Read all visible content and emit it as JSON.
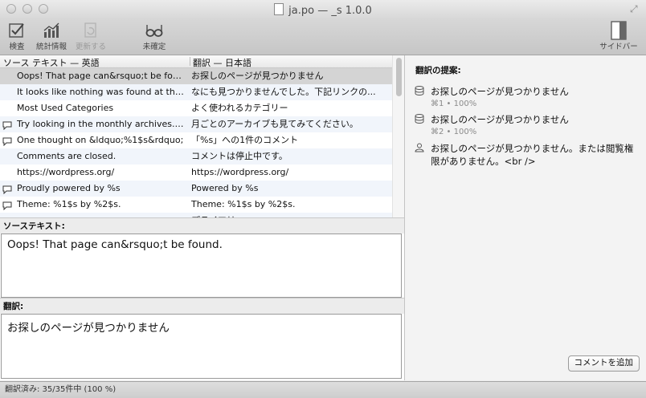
{
  "window": {
    "title": "ja.po — _s 1.0.0"
  },
  "toolbar": {
    "validate_label": "検査",
    "stats_label": "統計情報",
    "update_label": "更新する",
    "fuzzy_label": "未確定",
    "sidebar_label": "サイドバー"
  },
  "list": {
    "col_source": "ソース テキスト — 英語",
    "col_translation": "翻訳 — 日本語",
    "rows": [
      {
        "source": "Oops! That page can&rsquo;t be fou...",
        "translation": "お探しのページが見つかりません"
      },
      {
        "source": "It looks like nothing was found at thi...",
        "translation": "なにも見つかりませんでした。下記リンクの..."
      },
      {
        "source": "Most Used Categories",
        "translation": "よく使われるカテゴリー"
      },
      {
        "source": "Try looking in the monthly archives. ...",
        "translation": "月ごとのアーカイブも見てみてください。"
      },
      {
        "source": "One thought on &ldquo;%1$s&rdquo;",
        "translation": "「%s」への1件のコメント"
      },
      {
        "source": "Comments are closed.",
        "translation": "コメントは停止中です。"
      },
      {
        "source": "https://wordpress.org/",
        "translation": "https://wordpress.org/"
      },
      {
        "source": "Proudly powered by %s",
        "translation": "Powered by %s"
      },
      {
        "source": "Theme: %1$s by %2$s.",
        "translation": "Theme: %1$s by %2$s."
      },
      {
        "source": "",
        "translation": "プライマリ"
      }
    ]
  },
  "source_section": {
    "label": "ソーステキスト:",
    "text": "Oops! That page can&rsquo;t be found."
  },
  "translation_section": {
    "label": "翻訳:",
    "text": "お探しのページが見つかりません"
  },
  "sidebar": {
    "title": "翻訳の提案:",
    "suggestions": [
      {
        "text": "お探しのページが見つかりません",
        "meta": "⌘1 • 100%",
        "icon": "database-icon"
      },
      {
        "text": "お探しのページが見つかりません",
        "meta": "⌘2 • 100%",
        "icon": "database-icon"
      },
      {
        "text": "お探しのページが見つかりません。または閲覧権限がありません。<br />",
        "meta": "",
        "icon": "person-icon"
      }
    ],
    "add_comment_label": "コメントを追加"
  },
  "status": {
    "text": "翻訳済み: 35/35件中 (100 %)"
  }
}
